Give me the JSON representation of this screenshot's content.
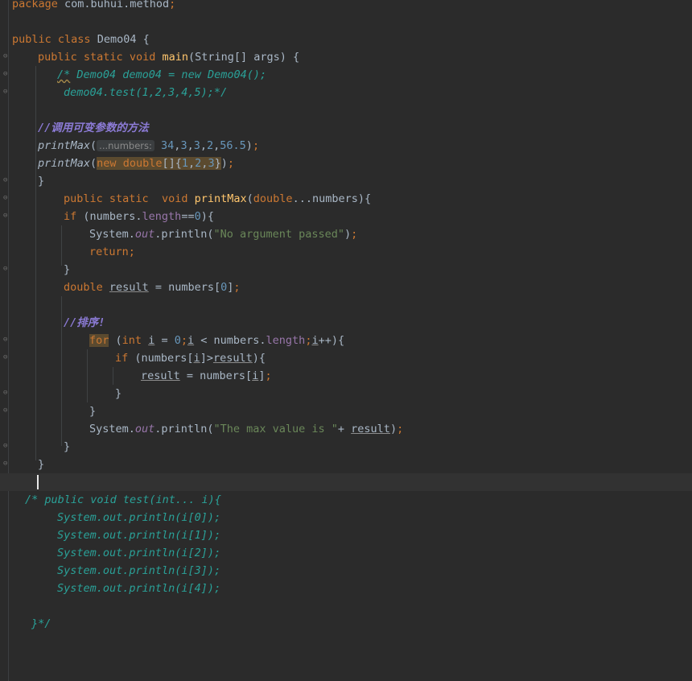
{
  "lines": [
    "package com.buhui.method;",
    "public class Demo04 {",
    "public static void main(String[] args) {",
    "/* Demo04 demo04 = new Demo04();",
    "demo04.test(1,2,3,4,5);*/",
    "//调用可变参数的方法",
    "printMax(34,3,3,2,56.5);",
    "printMax(new double[]{1,2,3});",
    "}",
    "public static  void printMax(double...numbers){",
    "if (numbers.length==0){",
    "System.out.println(\"No argument passed\");",
    "return;",
    "}",
    "double result = numbers[0];",
    "//排序!",
    "for (int i = 0;i < numbers.length;i++){",
    "if (numbers[i]>result){",
    "result = numbers[i];",
    "}",
    "}",
    "System.out.println(\"The max value is \"+ result);",
    "}",
    "}",
    "/* public void test(int... i){",
    "System.out.println(i[0]);",
    "System.out.println(i[1]);",
    "System.out.println(i[2]);",
    "System.out.println(i[3]);",
    "System.out.println(i[4]);",
    "}*/"
  ],
  "parameter_hint": "...numbers:",
  "colors": {
    "background": "#2b2b2b",
    "keyword": "#cc7832",
    "method": "#ffc66d",
    "number": "#6897bb",
    "string": "#6a8759",
    "field": "#9876aa",
    "comment": "#629755",
    "block_comment_teal": "#2aa198",
    "line_comment": "#8c7bd6"
  }
}
